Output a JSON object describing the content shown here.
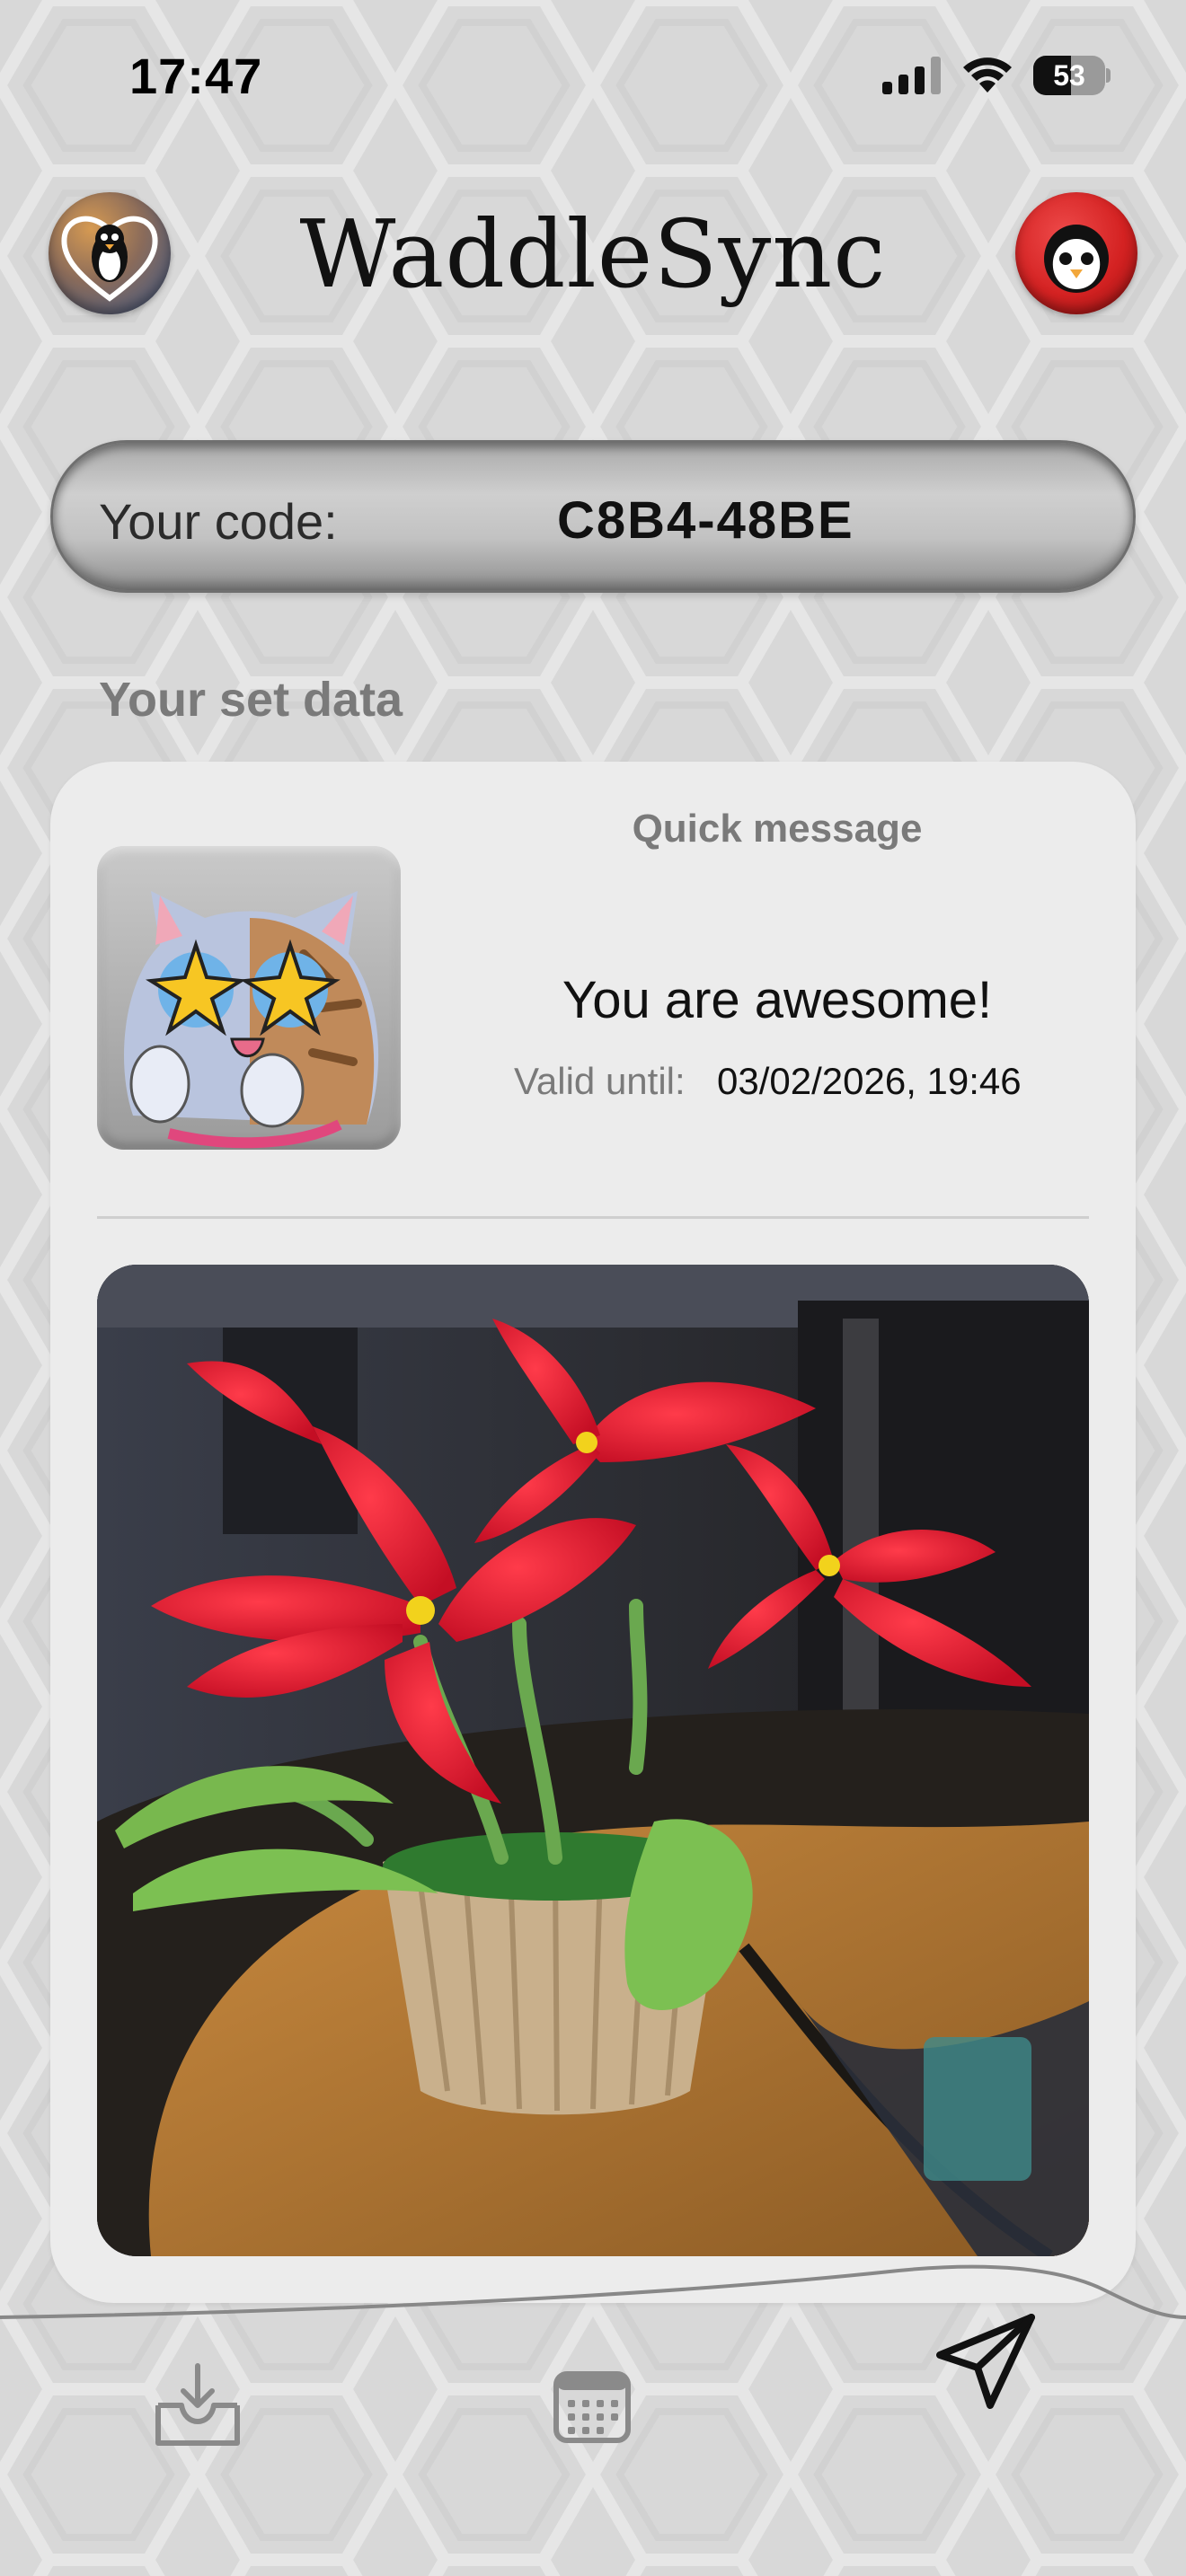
{
  "status_bar": {
    "time": "17:47",
    "battery": "53",
    "battery_level": 0.53
  },
  "header": {
    "title": "WaddleSync",
    "left_icon": "penguin-heart-icon",
    "right_icon": "penguin-face-icon"
  },
  "code": {
    "label": "Your code:",
    "value": "C8B4-48BE"
  },
  "section": {
    "title": "Your set data"
  },
  "card": {
    "sticker": "starstruck-cat-sticker",
    "quick_message": {
      "title": "Quick message",
      "text": "You are awesome!",
      "valid_label": "Valid until:",
      "valid_value": "03/02/2026, 19:46"
    },
    "photo": "red-pipe-cleaner-flowers-photo"
  },
  "tabbar": {
    "tabs": [
      {
        "icon": "inbox-download-icon",
        "active": false
      },
      {
        "icon": "calendar-icon",
        "active": false
      },
      {
        "icon": "send-paper-plane-icon",
        "active": true
      }
    ]
  },
  "colors": {
    "accent": "#111111",
    "muted": "#7a7a7a",
    "card": "#ececec",
    "background": "#dcdcdc"
  }
}
